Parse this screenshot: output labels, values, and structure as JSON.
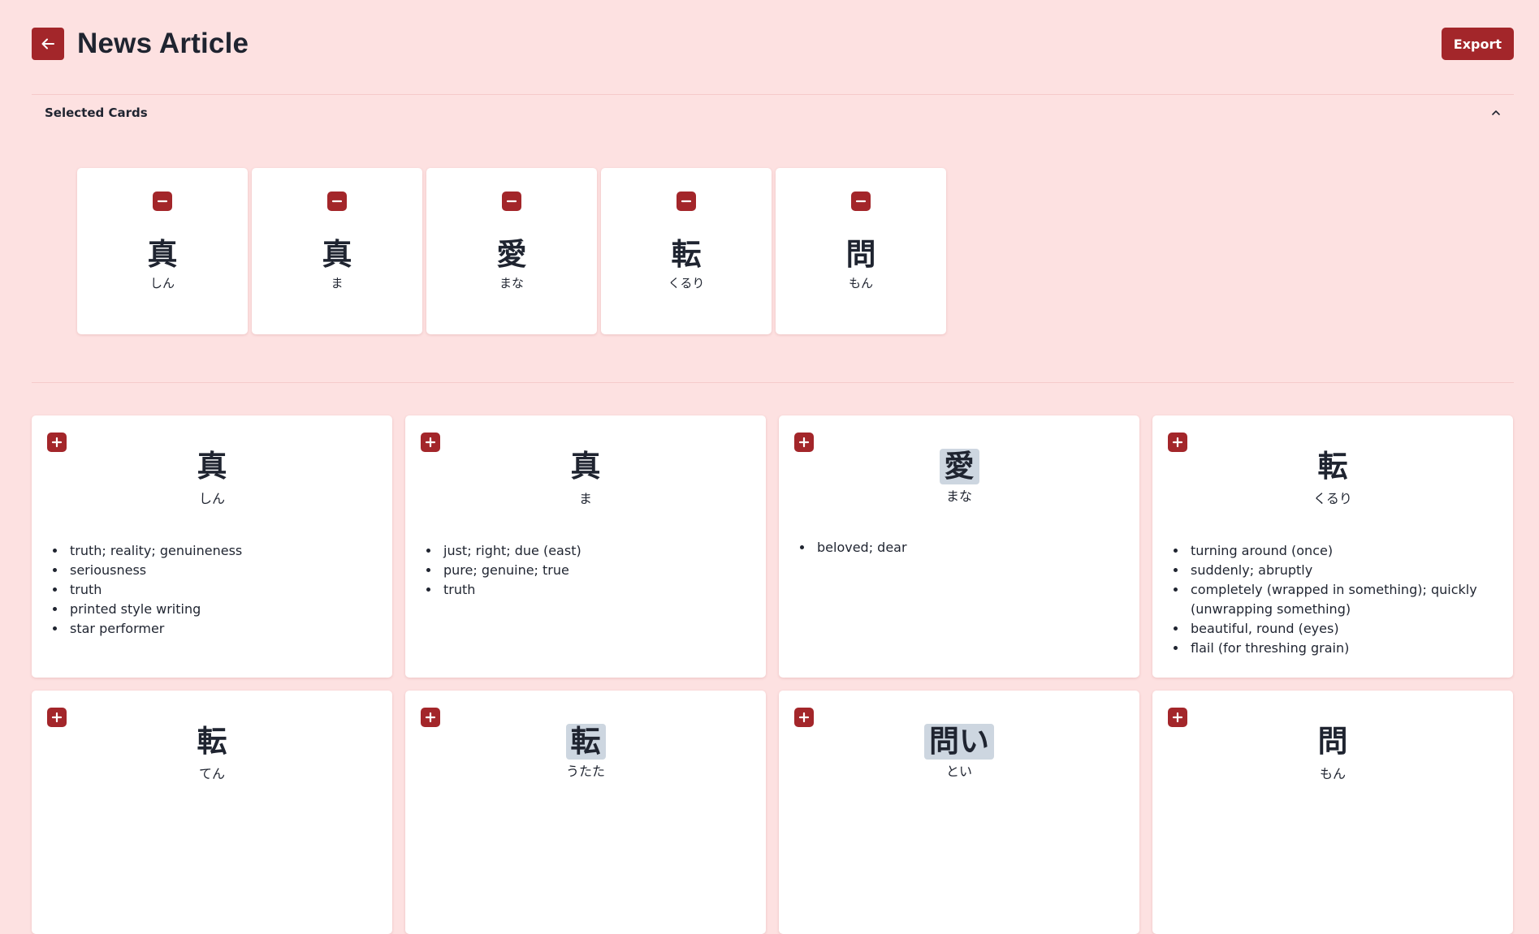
{
  "header": {
    "title": "News Article",
    "export_label": "Export"
  },
  "selected": {
    "title": "Selected Cards",
    "cards": [
      {
        "kanji": "真",
        "reading": "しん"
      },
      {
        "kanji": "真",
        "reading": "ま"
      },
      {
        "kanji": "愛",
        "reading": "まな"
      },
      {
        "kanji": "転",
        "reading": "くるり"
      },
      {
        "kanji": "問",
        "reading": "もん"
      }
    ]
  },
  "results": [
    {
      "kanji": "真",
      "reading": "しん",
      "highlight": false,
      "defs": [
        "truth; reality; genuineness",
        "seriousness",
        "truth",
        "printed style writing",
        "star performer"
      ]
    },
    {
      "kanji": "真",
      "reading": "ま",
      "highlight": false,
      "defs": [
        "just; right; due (east)",
        "pure; genuine; true",
        "truth"
      ]
    },
    {
      "kanji": "愛",
      "reading": "まな",
      "highlight": true,
      "defs": [
        "beloved; dear"
      ]
    },
    {
      "kanji": "転",
      "reading": "くるり",
      "highlight": false,
      "defs": [
        "turning around (once)",
        "suddenly; abruptly",
        "completely (wrapped in something); quickly (unwrapping something)",
        "beautiful, round (eyes)",
        "flail (for threshing grain)"
      ]
    },
    {
      "kanji": "転",
      "reading": "てん",
      "highlight": false,
      "defs": []
    },
    {
      "kanji": "転",
      "reading": "うたた",
      "highlight": true,
      "defs": []
    },
    {
      "kanji": "問い",
      "reading": "とい",
      "highlight": true,
      "defs": []
    },
    {
      "kanji": "問",
      "reading": "もん",
      "highlight": false,
      "defs": []
    }
  ],
  "colors": {
    "accent": "#a3262a",
    "background": "#fde1e1",
    "highlight": "#cdd6e0"
  }
}
